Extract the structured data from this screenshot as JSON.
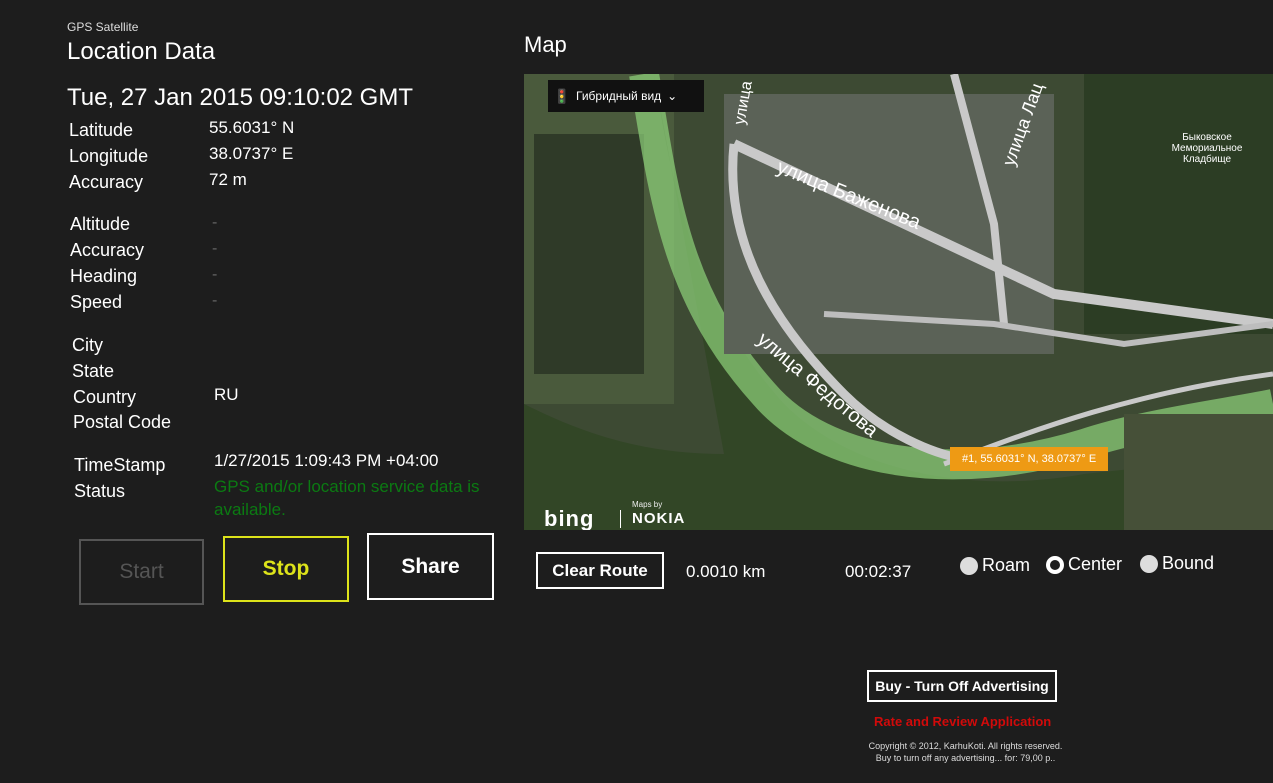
{
  "app": {
    "name": "GPS Satellite",
    "page_title": "Location Data"
  },
  "location": {
    "datetime": "Tue, 27 Jan 2015 09:10:02 GMT",
    "rows": [
      {
        "label": "Latitude",
        "value": "55.6031° N"
      },
      {
        "label": "Longitude",
        "value": "38.0737° E"
      },
      {
        "label": "Accuracy",
        "value": "72 m"
      }
    ],
    "alt_rows": [
      {
        "label": "Altitude",
        "value": "-"
      },
      {
        "label": "Accuracy",
        "value": "-"
      },
      {
        "label": "Heading",
        "value": "-"
      },
      {
        "label": "Speed",
        "value": "-"
      }
    ],
    "address": [
      {
        "label": "City",
        "value": ""
      },
      {
        "label": "State",
        "value": ""
      },
      {
        "label": "Country",
        "value": "RU"
      },
      {
        "label": "Postal Code",
        "value": ""
      }
    ],
    "timestamp_label": "TimeStamp",
    "timestamp_value": "1/27/2015 1:09:43 PM +04:00",
    "status_label": "Status",
    "status_value": "GPS and/or location service data is available."
  },
  "buttons": {
    "start": "Start",
    "stop": "Stop",
    "share": "Share"
  },
  "map": {
    "title": "Map",
    "type_label": "Гибридный вид",
    "type_chevron": "⌄",
    "streets": [
      "улица Баженова",
      "улица Федотова",
      "улица Лац",
      "улица"
    ],
    "poi": "Быковское Мемориальное Кладбище",
    "marker": "#1, 55.6031° N, 38.0737° E",
    "bing": "bing",
    "maps_by": "Maps by",
    "nokia": "NOKIA"
  },
  "route": {
    "clear_label": "Clear Route",
    "distance": "0.0010 km",
    "duration": "00:02:37",
    "modes": [
      {
        "label": "Roam",
        "selected": false
      },
      {
        "label": "Center",
        "selected": true
      },
      {
        "label": "Bound",
        "selected": false
      }
    ]
  },
  "footer": {
    "buy": "Buy - Turn Off Advertising",
    "rate": "Rate and Review Application",
    "copyright": "Copyright © 2012, KarhuKoti. All rights reserved.",
    "buy_note": "Buy to turn off any advertising... for: 79,00 p.."
  },
  "colors": {
    "accent_yellow": "#dde31a",
    "status_green": "#0b7a12",
    "marker_orange": "#ee9a14",
    "rate_red": "#d10a0a"
  }
}
